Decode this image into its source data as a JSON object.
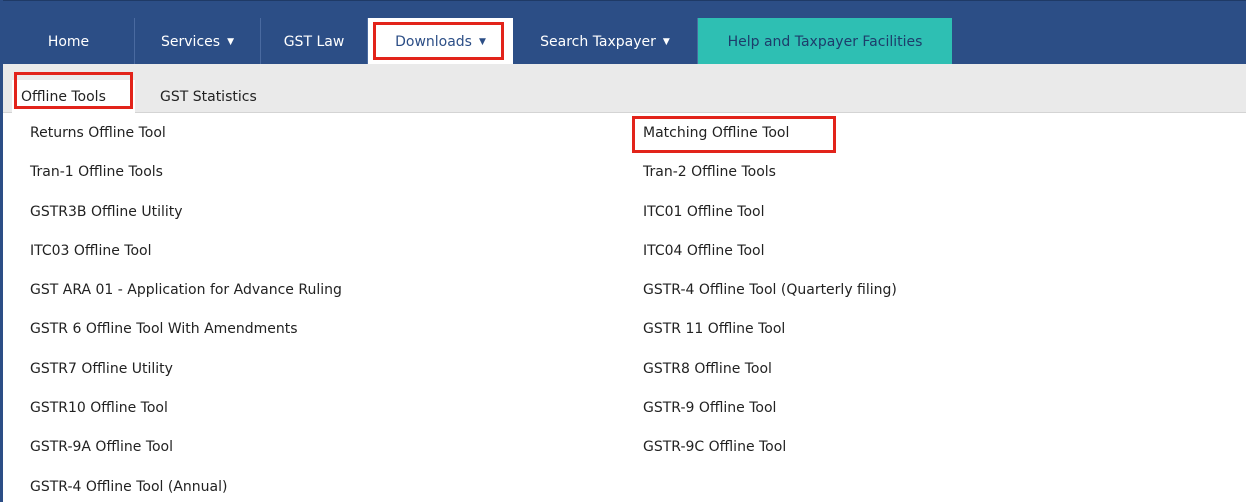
{
  "nav": {
    "home": "Home",
    "services": "Services",
    "gst_law": "GST Law",
    "downloads": "Downloads",
    "search_taxpayer": "Search Taxpayer",
    "help": "Help and Taxpayer Facilities",
    "caret": "▼"
  },
  "subnav": {
    "offline_tools": "Offline Tools",
    "gst_statistics": "GST Statistics"
  },
  "left_links": [
    "Returns Offline Tool",
    "Tran-1 Offline Tools",
    "GSTR3B Offline Utility",
    "ITC03 Offline Tool",
    "GST ARA 01 - Application for Advance Ruling",
    "GSTR 6 Offline Tool With Amendments",
    "GSTR7 Offline Utility",
    "GSTR10 Offline Tool",
    "GSTR-9A Offline Tool",
    "GSTR-4 Offline Tool (Annual)"
  ],
  "right_links": [
    "Matching Offline Tool",
    "Tran-2 Offline Tools",
    "ITC01 Offline Tool",
    "ITC04 Offline Tool",
    "GSTR-4 Offline Tool (Quarterly filing)",
    "GSTR 11 Offline Tool",
    "GSTR8 Offline Tool",
    "GSTR-9 Offline Tool",
    "GSTR-9C Offline Tool"
  ],
  "colors": {
    "nav_bg": "#2c4e86",
    "help_bg": "#2ebfb3",
    "highlight": "#e2231a",
    "subnav_bg": "#eaeaea"
  }
}
